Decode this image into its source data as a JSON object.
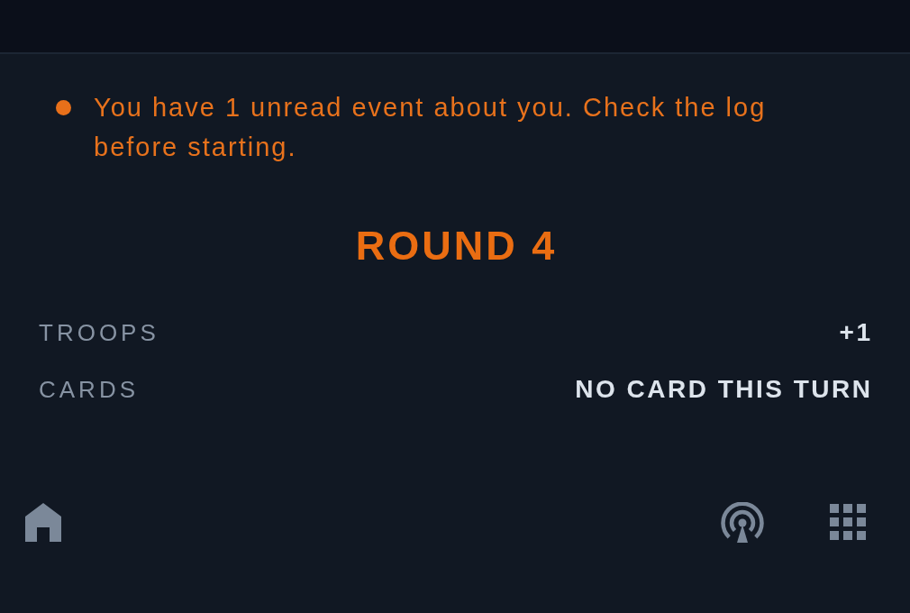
{
  "alert": {
    "text": "You have 1 unread event about you. Check the log before starting."
  },
  "round_title": "ROUND 4",
  "stats": [
    {
      "label": "TROOPS",
      "value": "+1"
    },
    {
      "label": "CARDS",
      "value": "NO CARD THIS TURN"
    }
  ]
}
